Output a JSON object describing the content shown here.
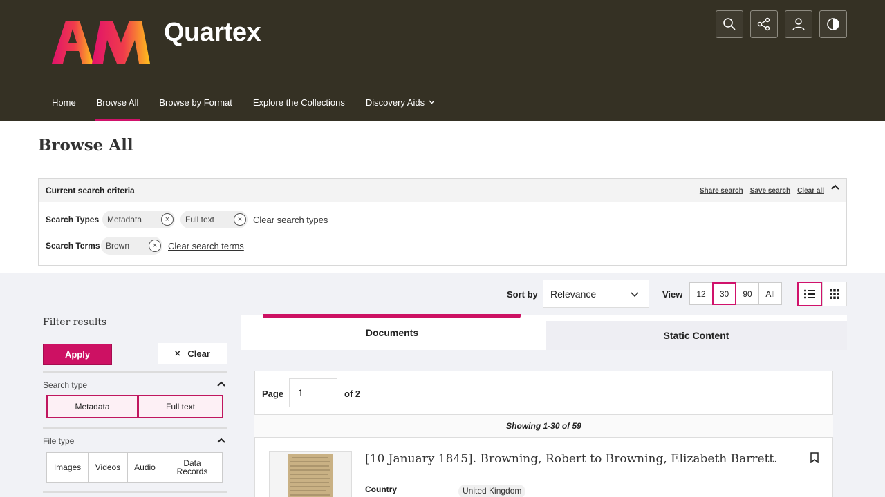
{
  "header": {
    "logo_text": "Quartex",
    "nav": [
      "Home",
      "Browse All",
      "Browse by Format",
      "Explore the Collections",
      "Discovery Aids"
    ],
    "icons": [
      "search-icon",
      "share-icon",
      "user-icon",
      "contrast-icon"
    ],
    "accent_color": "#d0126b"
  },
  "page": {
    "title": "Browse All"
  },
  "criteria": {
    "title": "Current search criteria",
    "links": [
      "Share search",
      "Save search",
      "Clear all"
    ],
    "types_label": "Search Types",
    "types": [
      "Metadata",
      "Full text"
    ],
    "clear_types": "Clear search types",
    "terms_label": "Search Terms",
    "terms": [
      "Brown"
    ],
    "clear_terms": "Clear search terms"
  },
  "controls": {
    "sort_label": "Sort by",
    "sort_value": "Relevance",
    "view_label": "View",
    "view_options": [
      "12",
      "30",
      "90",
      "All"
    ],
    "view_selected": "30"
  },
  "filters": {
    "title": "Filter results",
    "apply": "Apply",
    "clear": "Clear",
    "search_type_label": "Search type",
    "search_types": [
      "Metadata",
      "Full text"
    ],
    "file_type_label": "File type",
    "file_types": [
      "Images",
      "Videos",
      "Audio",
      "Data Records"
    ]
  },
  "results": {
    "tabs": [
      "Documents",
      "Static Content"
    ],
    "page_label": "Page",
    "page_value": "1",
    "page_of": "of 2",
    "showing": "Showing 1-30 of 59",
    "item_title": "[10 January 1845]. Browning, Robert to Browning, Elizabeth Barrett.",
    "country_label": "Country",
    "country_value": "United Kingdom"
  }
}
